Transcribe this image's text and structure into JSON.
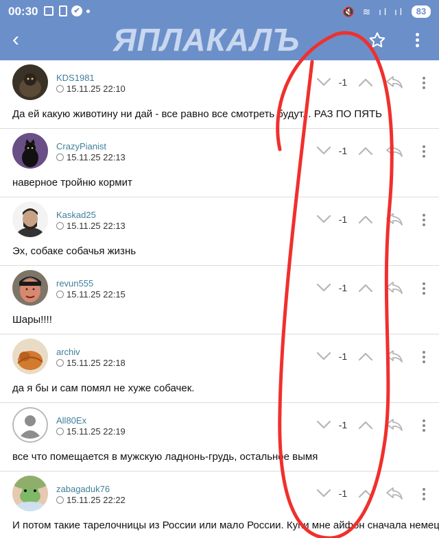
{
  "status_bar": {
    "time": "00:30",
    "battery": "83",
    "check_glyph": "✔",
    "signal_glyphs": "🔇 ≋ ıl ıl"
  },
  "header": {
    "logo": "ЯПЛАКАЛЪ",
    "back_icon": "chevron-left-icon",
    "star_icon": "star-icon",
    "menu_icon": "more-vertical-icon",
    "back_glyph": "‹",
    "color": "#6b8fc9"
  },
  "comments": [
    {
      "username": "KDS1981",
      "time": "15.11.25 22:10",
      "rating": "-1",
      "text": "Да ей какую животину ни дай - все равно все смотреть будут... РАЗ ПО ПЯТЬ",
      "avatar": "cat-dark"
    },
    {
      "username": "CrazyPianist",
      "time": "15.11.25 22:13",
      "rating": "-1",
      "text": "наверное тройню кормит",
      "avatar": "black-cat-purple"
    },
    {
      "username": "Kaskad25",
      "time": "15.11.25 22:13",
      "rating": "-1",
      "text": "Эх, собаке собачья жизнь",
      "avatar": "man-beard"
    },
    {
      "username": "revun555",
      "time": "15.11.25 22:15",
      "rating": "-1",
      "text": "Шары!!!!",
      "avatar": "man-beanie"
    },
    {
      "username": "archiv",
      "time": "15.11.25 22:18",
      "rating": "-1",
      "text": "да я бы и сам помял не хуже собачек.",
      "avatar": "orange-cat"
    },
    {
      "username": "All80Ex",
      "time": "15.11.25 22:19",
      "rating": "-1",
      "text": "все что помещается в мужскую ладнонь-грудь, остальное вымя",
      "avatar": "default-silhouette"
    },
    {
      "username": "zabagaduk76",
      "time": "15.11.25 22:22",
      "rating": "-1",
      "text": "И потом такие тарелочницы из России или мало России. Купи мне айфон сначала немец!",
      "avatar": "frog"
    }
  ]
}
